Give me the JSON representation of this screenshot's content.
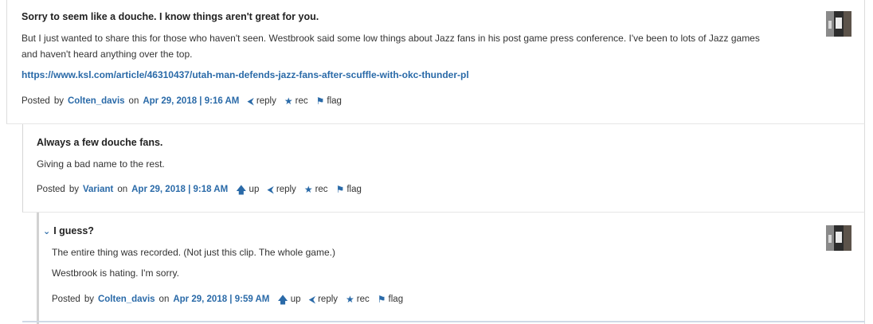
{
  "posts": [
    {
      "title": "Sorry to seem like a douche. I know things aren't great for you.",
      "body": [
        "But I just wanted to share this for those who haven't seen. Westbrook said some low things about Jazz fans in his post game press conference. I've been to lots of Jazz games",
        "and haven't heard anything over the top."
      ],
      "link": "https://www.ksl.com/article/46310437/utah-man-defends-jazz-fans-after-scuffle-with-okc-thunder-pl",
      "posted_label": "Posted",
      "by_label": "by",
      "user": "Colten_davis",
      "on_label": "on",
      "date": "Apr 29, 2018 | 9:16 AM",
      "actions": {
        "reply": "reply",
        "rec": "rec",
        "flag": "flag"
      }
    },
    {
      "title": "Always a few douche fans.",
      "body": [
        "Giving a bad name to the rest."
      ],
      "posted_label": "Posted",
      "by_label": "by",
      "user": "Variant",
      "on_label": "on",
      "date": "Apr 29, 2018 | 9:18 AM",
      "actions": {
        "up": "up",
        "reply": "reply",
        "rec": "rec",
        "flag": "flag"
      }
    },
    {
      "title": "I guess?",
      "body": [
        "The entire thing was recorded. (Not just this clip. The whole game.)",
        "Westbrook is hating. I'm sorry."
      ],
      "posted_label": "Posted",
      "by_label": "by",
      "user": "Colten_davis",
      "on_label": "on",
      "date": "Apr 29, 2018 | 9:59 AM",
      "actions": {
        "up": "up",
        "reply": "reply",
        "rec": "rec",
        "flag": "flag"
      }
    }
  ],
  "icons": {
    "up": "arrow-up-icon",
    "reply": "reply-arrow-icon",
    "rec": "star-icon",
    "flag": "flag-icon",
    "collapse": "chevron-down-icon"
  },
  "colors": {
    "link": "#2a6aa8",
    "text": "#222222"
  }
}
